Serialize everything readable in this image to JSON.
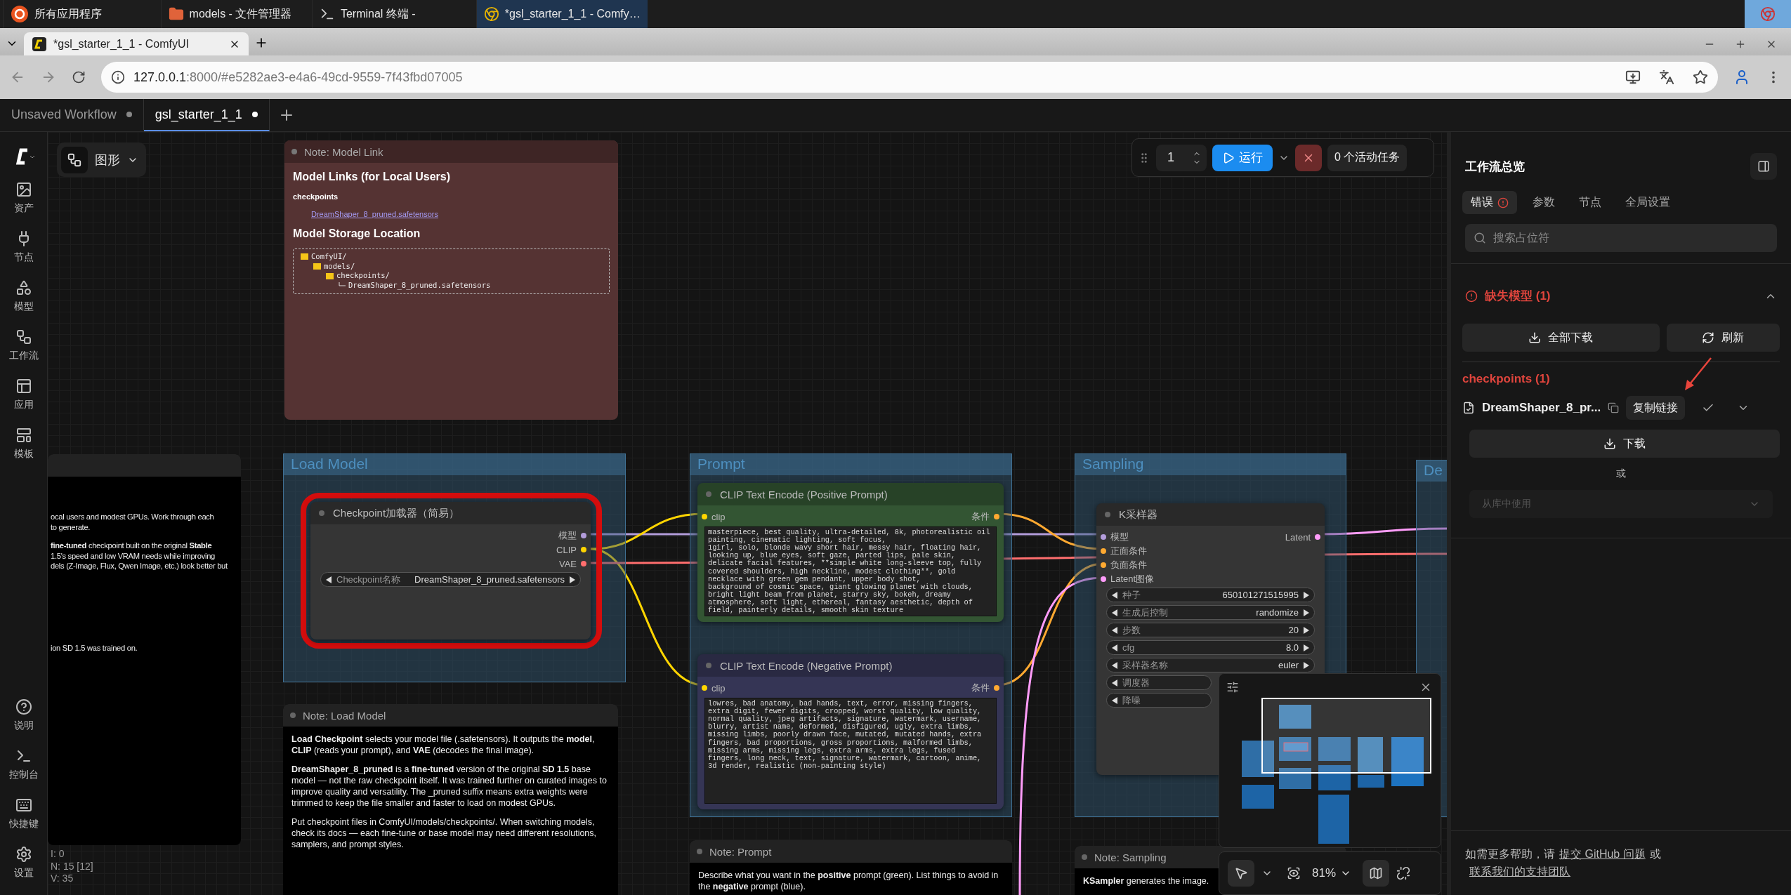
{
  "taskbar": {
    "items": [
      {
        "label": "所有应用程序",
        "kind": "launcher",
        "selected": false
      },
      {
        "label": "models - 文件管理器",
        "kind": "folder",
        "selected": false
      },
      {
        "label": "Terminal 终端 -",
        "kind": "terminal",
        "selected": false
      },
      {
        "label": "*gsl_starter_1_1 - Comfy…",
        "kind": "browser",
        "selected": true
      }
    ]
  },
  "browser": {
    "tab_title": "*gsl_starter_1_1 - ComfyUI",
    "url_host": "127.0.0.1",
    "url_rest": ":8000/#e5282ae3-e4a6-49cd-9559-7f43fbd07005"
  },
  "workflow_tabs": [
    {
      "label": "Unsaved Workflow",
      "selected": false,
      "modified": true
    },
    {
      "label": "gsl_starter_1_1",
      "selected": true,
      "modified": true
    }
  ],
  "sidebar": {
    "top": [
      {
        "label": "资产",
        "kind": "assets"
      },
      {
        "label": "节点",
        "kind": "nodes"
      },
      {
        "label": "模型",
        "kind": "models"
      },
      {
        "label": "工作流",
        "kind": "workflow"
      },
      {
        "label": "应用",
        "kind": "apps"
      },
      {
        "label": "模板",
        "kind": "templates"
      }
    ],
    "bottom": [
      {
        "label": "说明",
        "kind": "help"
      },
      {
        "label": "控制台",
        "kind": "console"
      },
      {
        "label": "快捷键",
        "kind": "keyboard"
      },
      {
        "label": "设置",
        "kind": "settings"
      }
    ]
  },
  "canvas": {
    "view_mode": "图形",
    "model_link_note": {
      "title": "Note: Model Link",
      "heading": "Model Links (for Local Users)",
      "subheading": "checkpoints",
      "link": "DreamShaper_8_pruned.safetensors",
      "storage_heading": "Model Storage Location",
      "tree": [
        {
          "name": "ComfyUI/",
          "folder": true,
          "children": [
            {
              "name": "models/",
              "folder": true,
              "children": [
                {
                  "name": "checkpoints/",
                  "folder": true,
                  "children": [
                    {
                      "name": "DreamShaper_8_pruned.safetensors",
                      "folder": false
                    }
                  ]
                }
              ]
            }
          ]
        }
      ]
    },
    "side_note": {
      "paragraphs": [
        [
          "ocal users and modest GPUs. Work through each",
          "to generate."
        ],
        [
          "**fine-tuned** checkpoint built on the original **Stable**",
          "1.5's speed and low VRAM needs while improving",
          "dels (Z-Image, Flux, Qwen Image, etc.) look better but"
        ],
        [
          "ion SD 1.5 was trained on."
        ]
      ]
    },
    "stats": [
      "I: 0",
      "N: 15 [12]",
      "V: 35"
    ],
    "groups": [
      {
        "title": "Load Model"
      },
      {
        "title": "Prompt"
      },
      {
        "title": "Sampling"
      },
      {
        "title": "De"
      }
    ],
    "nodes": [
      {
        "title": "Checkpoint加载器（简易）",
        "color": "#353535",
        "highlighted": true,
        "outputs": [
          {
            "label": "模型",
            "color": "#b39ddb"
          },
          {
            "label": "CLIP",
            "color": "#ffd500"
          },
          {
            "label": "VAE",
            "color": "#ff6e6e"
          }
        ],
        "widgets": [
          {
            "label": "Checkpoint名称",
            "value": "DreamShaper_8_pruned.safetensors"
          }
        ]
      },
      {
        "title": "CLIP Text Encode (Positive Prompt)",
        "color": "#335533",
        "highlighted": false,
        "inputs": [
          {
            "label": "clip",
            "color": "#ffd500"
          }
        ],
        "outputs": [
          {
            "label": "条件",
            "color": "#ffa931"
          }
        ],
        "text": "masterpiece, best quality, ultra-detailed, 8k, photorealistic oil painting, cinematic lighting, soft focus,\n1girl, solo, blonde wavy short hair, messy hair, floating hair, looking up, blue eyes, soft gaze, parted lips, pale skin, delicate facial features, **simple white long-sleeve top, fully covered shoulders, high neckline, modest clothing**, gold necklace with green gem pendant, upper body shot,\nbackground of cosmic space, giant glowing planet with clouds, bright light beam from planet, starry sky, bokeh, dreamy atmosphere, soft light, ethereal, fantasy aesthetic, depth of field, painterly details, smooth skin texture"
      },
      {
        "title": "CLIP Text Encode (Negative Prompt)",
        "color": "#353555",
        "highlighted": false,
        "inputs": [
          {
            "label": "clip",
            "color": "#ffd500"
          }
        ],
        "outputs": [
          {
            "label": "条件",
            "color": "#ffa931"
          }
        ],
        "text": "lowres, bad anatomy, bad hands, text, error, missing fingers, extra digit, fewer digits, cropped, worst quality, low quality, normal quality, jpeg artifacts, signature, watermark, username, blurry, artist name, deformed, disfigured, ugly, extra limbs, missing limbs, poorly drawn face, mutated, mutated hands, extra fingers, bad proportions, gross proportions, malformed limbs, missing arms, missing legs, extra arms, extra legs, fused fingers, long neck, text, signature, watermark, cartoon, anime, 3d render, realistic (non-painting style)"
      },
      {
        "title": "K采样器",
        "color": "#353535",
        "highlighted": false,
        "inputs": [
          {
            "label": "模型",
            "color": "#b39ddb"
          },
          {
            "label": "正面条件",
            "color": "#ffa931"
          },
          {
            "label": "负面条件",
            "color": "#ffa931"
          },
          {
            "label": "Latent图像",
            "color": "#ff9cf9"
          }
        ],
        "outputs": [
          {
            "label": "Latent",
            "color": "#ff9cf9"
          }
        ],
        "widgets": [
          {
            "label": "种子",
            "value": "650101271515995"
          },
          {
            "label": "生成后控制",
            "value": "randomize"
          },
          {
            "label": "步数",
            "value": "20"
          },
          {
            "label": "cfg",
            "value": "8.0"
          },
          {
            "label": "采样器名称",
            "value": "euler"
          },
          {
            "label": "调度器"
          },
          {
            "label": "降噪"
          }
        ]
      }
    ],
    "notes": [
      {
        "title": "Note: Load Model",
        "paragraphs": [
          "**Load Checkpoint** selects your model file (.safetensors). It outputs the **model**, **CLIP** (reads your prompt), and **VAE** (decodes the final image).",
          "**DreamShaper_8_pruned** is a **fine-tuned** version of the original **SD 1.5** base model — not the raw checkpoint itself. It was trained further on curated images to improve quality and versatility. The _pruned suffix means extra weights were trimmed to keep the file smaller and faster to load on modest GPUs.",
          "Put checkpoint files in ComfyUI/models/checkpoints/. When switching models, check its docs — each fine-tune or base model may need different resolutions, samplers, and prompt styles."
        ]
      },
      {
        "title": "Note: Prompt",
        "paragraphs": [
          "Describe what you want in the **positive** prompt (green). List things to avoid in the **negative** prompt (blue)."
        ]
      },
      {
        "title": "Note: Sampling",
        "paragraphs": [
          "**KSampler** generates the image."
        ]
      }
    ]
  },
  "run_toolbar": {
    "count": "1",
    "run_label": "运行",
    "active_tasks": "0 个活动任务"
  },
  "view_toolbar": {
    "zoom": "81%",
    "select_mode": true,
    "minimap_on": true
  },
  "panel": {
    "title": "工作流总览",
    "tabs": [
      {
        "label": "错误",
        "selected": true,
        "alert": true
      },
      {
        "label": "参数",
        "selected": false,
        "alert": false
      },
      {
        "label": "节点",
        "selected": false,
        "alert": false
      },
      {
        "label": "全局设置",
        "selected": false,
        "alert": false
      }
    ],
    "search_placeholder": "搜索占位符",
    "section": {
      "title": "缺失模型 (1)",
      "expanded": true,
      "download_all": "全部下载",
      "refresh": "刷新",
      "group": "checkpoints (1)",
      "model": {
        "name": "DreamShaper_8_pr...",
        "copy_link": "复制链接",
        "annotated": true
      },
      "download": "下载",
      "or": "或",
      "library_select": {
        "placeholder": "从库中使用",
        "disabled": true
      }
    },
    "help": {
      "before": "如需更多帮助，请",
      "link_issue": "提交 GitHub 问题",
      "middle": "或",
      "link_support": "联系我们的支持团队"
    }
  }
}
